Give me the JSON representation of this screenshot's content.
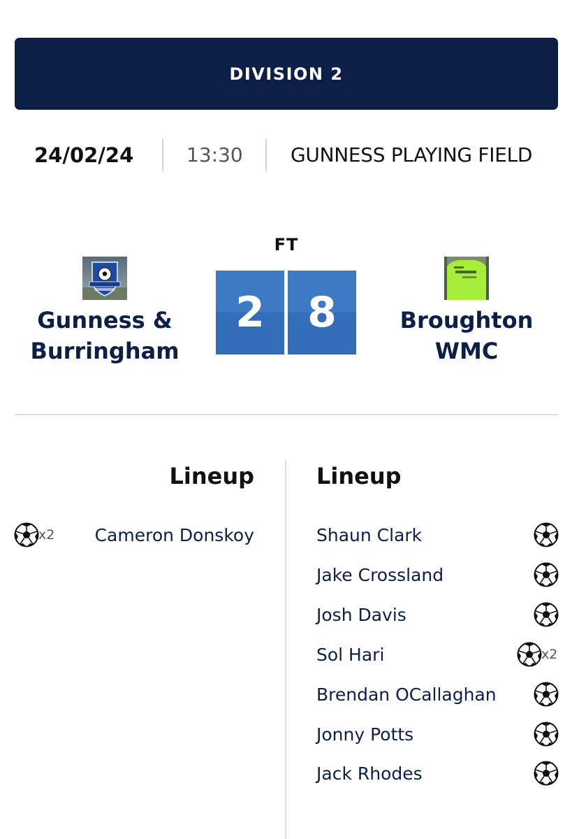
{
  "division": "DIVISION 2",
  "match": {
    "date": "24/02/24",
    "time": "13:30",
    "venue": "GUNNESS PLAYING FIELD",
    "status": "FT",
    "home": {
      "name_line1": "Gunness &",
      "name_line2": "Burringham",
      "score": "2",
      "crest_icon": "club-crest-icon",
      "lineup_title": "Lineup",
      "players": [
        {
          "name": "Cameron Donskoy",
          "goals": "x2"
        }
      ]
    },
    "away": {
      "name_line1": "Broughton",
      "name_line2": "WMC",
      "score": "8",
      "crest_icon": "team-photo-icon",
      "lineup_title": "Lineup",
      "players": [
        {
          "name": "Shaun Clark",
          "goals": ""
        },
        {
          "name": "Jake Crossland",
          "goals": ""
        },
        {
          "name": "Josh Davis",
          "goals": ""
        },
        {
          "name": "Sol Hari",
          "goals": "x2"
        },
        {
          "name": "Brendan OCallaghan",
          "goals": ""
        },
        {
          "name": "Jonny Potts",
          "goals": ""
        },
        {
          "name": "Jack Rhodes",
          "goals": ""
        }
      ]
    }
  },
  "colors": {
    "navy": "#0b1f47",
    "score_blue": "#3e79c3",
    "divider": "#dedede"
  }
}
